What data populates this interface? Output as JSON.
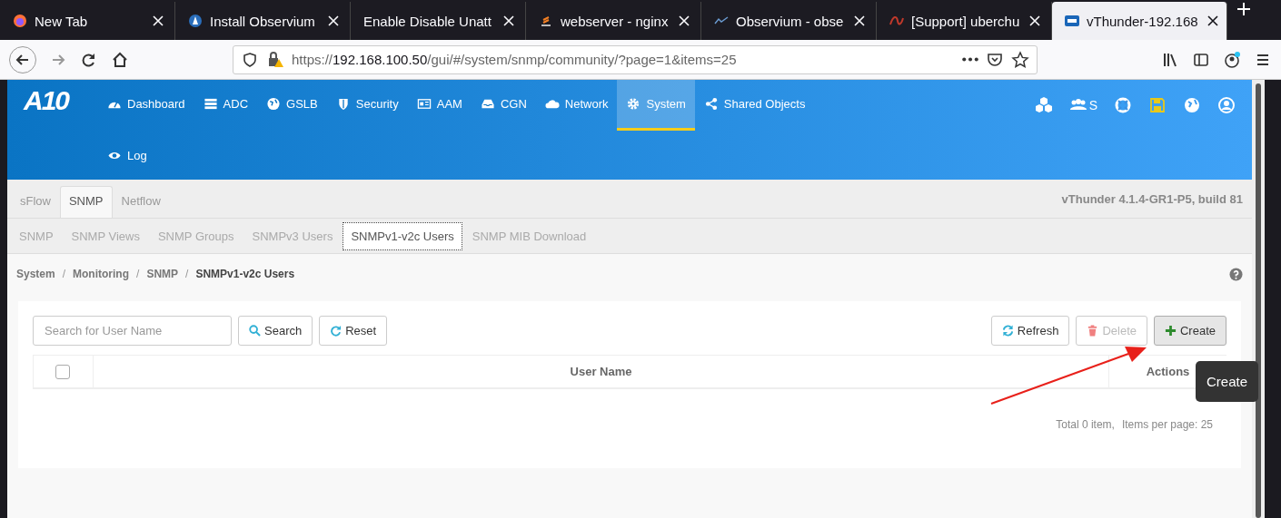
{
  "browser": {
    "tabs": [
      {
        "title": "New Tab",
        "selected": false
      },
      {
        "title": "Install Observium",
        "selected": false
      },
      {
        "title": "Enable Disable Unatt",
        "selected": false
      },
      {
        "title": "webserver - nginx",
        "selected": false
      },
      {
        "title": "Observium - obse",
        "selected": false
      },
      {
        "title": "[Support] uberchu",
        "selected": false
      },
      {
        "title": "vThunder-192.168",
        "selected": true
      }
    ],
    "url": {
      "scheme": "https://",
      "host": "192.168.100.50",
      "path": "/gui/#/system/snmp/community/?page=1&items=25"
    }
  },
  "header": {
    "logo": "A10",
    "nav": [
      {
        "label": "Dashboard",
        "selected": false
      },
      {
        "label": "ADC",
        "selected": false
      },
      {
        "label": "GSLB",
        "selected": false
      },
      {
        "label": "Security",
        "selected": false
      },
      {
        "label": "AAM",
        "selected": false
      },
      {
        "label": "CGN",
        "selected": false
      },
      {
        "label": "Network",
        "selected": false
      },
      {
        "label": "System",
        "selected": true
      },
      {
        "label": "Shared Objects",
        "selected": false
      },
      {
        "label": "Log",
        "selected": false
      }
    ],
    "partition": "S"
  },
  "tabs": [
    {
      "label": "sFlow",
      "selected": false
    },
    {
      "label": "SNMP",
      "selected": true
    },
    {
      "label": "Netflow",
      "selected": false
    }
  ],
  "version": "vThunder 4.1.4-GR1-P5, build 81",
  "subtabs": [
    {
      "label": "SNMP",
      "selected": false
    },
    {
      "label": "SNMP Views",
      "selected": false
    },
    {
      "label": "SNMP Groups",
      "selected": false
    },
    {
      "label": "SNMPv3 Users",
      "selected": false
    },
    {
      "label": "SNMPv1-v2c Users",
      "selected": true
    },
    {
      "label": "SNMP MIB Download",
      "selected": false
    }
  ],
  "breadcrumb": [
    "System",
    "Monitoring",
    "SNMP",
    "SNMPv1-v2c Users"
  ],
  "breadcrumb_separator": "/",
  "search": {
    "placeholder": "Search for User Name",
    "search_button": "Search",
    "reset_button": "Reset"
  },
  "actions": [
    {
      "label": "Refresh",
      "disabled": false,
      "highlighted": false
    },
    {
      "label": "Delete",
      "disabled": true,
      "highlighted": false
    },
    {
      "label": "Create",
      "disabled": false,
      "highlighted": true
    }
  ],
  "table": {
    "select_all_checked": false,
    "columns": [
      "User Name",
      "Actions"
    ]
  },
  "footer": {
    "total": "Total 0 item,",
    "per_page": "Items per page: 25"
  },
  "tooltip": "Create"
}
